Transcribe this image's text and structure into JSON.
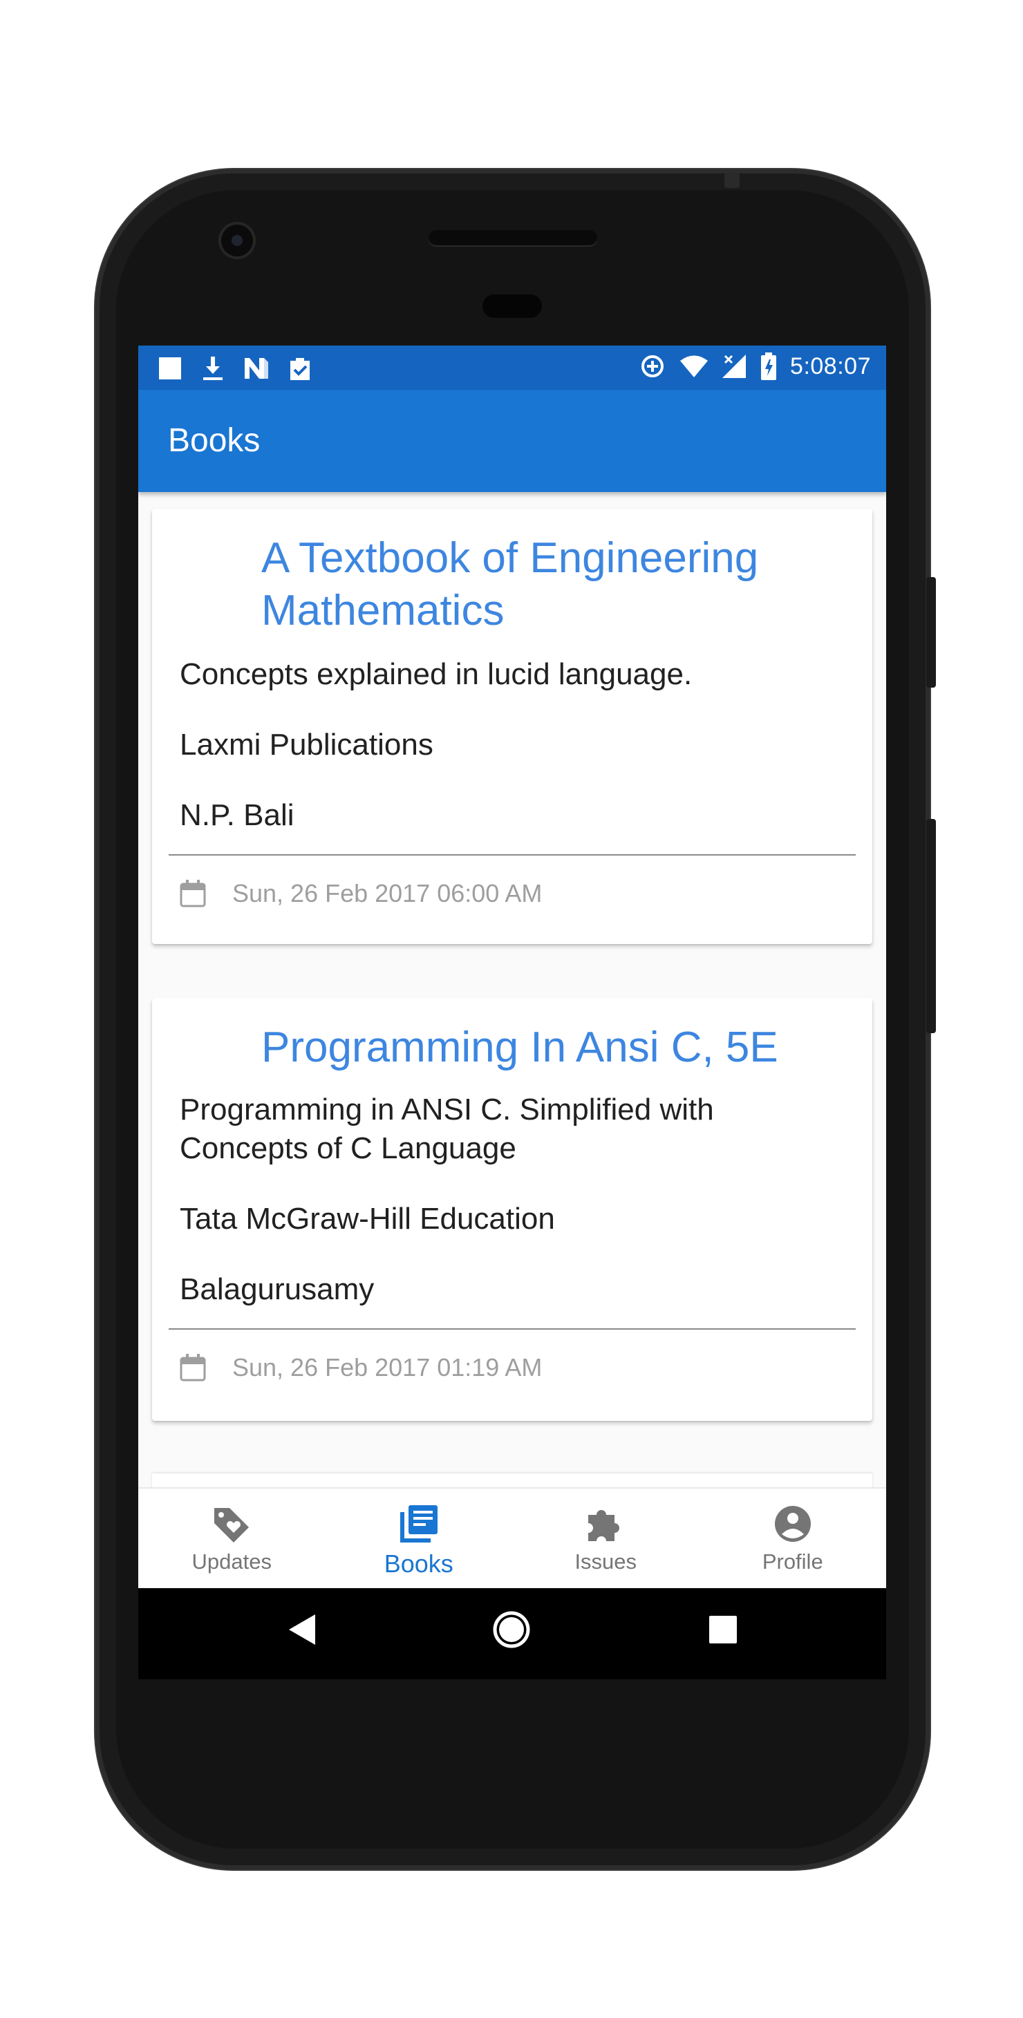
{
  "status_bar": {
    "time": "5:08:07",
    "left_icons": [
      "square-icon",
      "download-icon",
      "n-logo-icon",
      "clipboard-check-icon"
    ],
    "right_icons": [
      "data-saver-icon",
      "wifi-icon",
      "signal-icon",
      "battery-charging-icon"
    ]
  },
  "app_bar": {
    "title": "Books",
    "color": "#1976d2"
  },
  "books": [
    {
      "title": "A Textbook of Engineering Mathematics",
      "description": "Concepts explained in lucid language.",
      "publisher": "Laxmi Publications",
      "author": "N.P. Bali",
      "date": "Sun, 26 Feb 2017 06:00 AM"
    },
    {
      "title": "Programming In Ansi C, 5E",
      "description": "Programming in ANSI C. Simplified with Concepts of C Language",
      "publisher": "Tata McGraw-Hill Education",
      "author": "Balagurusamy",
      "date": "Sun, 26 Feb 2017 01:19 AM"
    }
  ],
  "bottom_nav": {
    "active": "Books",
    "active_color": "#1976d2",
    "items": [
      {
        "label": "Updates",
        "icon": "tag-heart-icon"
      },
      {
        "label": "Books",
        "icon": "library-books-icon"
      },
      {
        "label": "Issues",
        "icon": "puzzle-icon"
      },
      {
        "label": "Profile",
        "icon": "account-circle-icon"
      }
    ]
  },
  "system_nav": {
    "icons": [
      "back-icon",
      "home-icon",
      "recents-icon"
    ]
  }
}
